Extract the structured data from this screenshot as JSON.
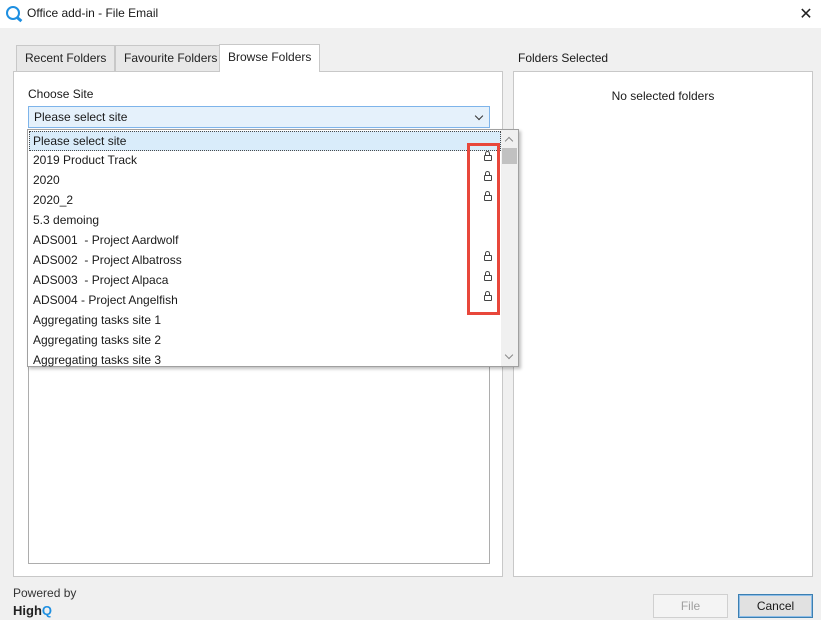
{
  "window": {
    "title": "Office add-in - File Email",
    "close_glyph": "✕"
  },
  "tabs": [
    {
      "label": "Recent Folders",
      "active": false
    },
    {
      "label": "Favourite Folders",
      "active": false
    },
    {
      "label": "Browse Folders",
      "active": true
    }
  ],
  "browse": {
    "choose_site_label": "Choose Site",
    "select_value": "Please select site",
    "dropdown_options": [
      {
        "label": "Please select site",
        "locked": false,
        "selected": true
      },
      {
        "label": "2019 Product Track",
        "locked": true
      },
      {
        "label": "2020",
        "locked": true
      },
      {
        "label": "2020_2",
        "locked": true
      },
      {
        "label": "5.3 demoing",
        "locked": false
      },
      {
        "label": "ADS001  - Project Aardwolf",
        "locked": false
      },
      {
        "label": "ADS002  - Project Albatross",
        "locked": true
      },
      {
        "label": "ADS003  - Project Alpaca",
        "locked": true
      },
      {
        "label": "ADS004 - Project Angelfish",
        "locked": true
      },
      {
        "label": "Aggregating tasks site 1",
        "locked": false
      },
      {
        "label": "Aggregating tasks site 2",
        "locked": false
      },
      {
        "label": "Aggregating tasks site 3",
        "locked": false
      }
    ],
    "lock_icon": "lock-icon",
    "highlight_color": "#e8473b"
  },
  "selected_panel": {
    "label": "Folders Selected",
    "empty_text": "No selected folders"
  },
  "footer": {
    "powered_by": "Powered by",
    "brand_prefix": "High",
    "brand_q": "Q",
    "file_button": "File",
    "cancel_button": "Cancel"
  },
  "colors": {
    "accent": "#1e8fe1",
    "select_bg": "#e5f1fb"
  }
}
